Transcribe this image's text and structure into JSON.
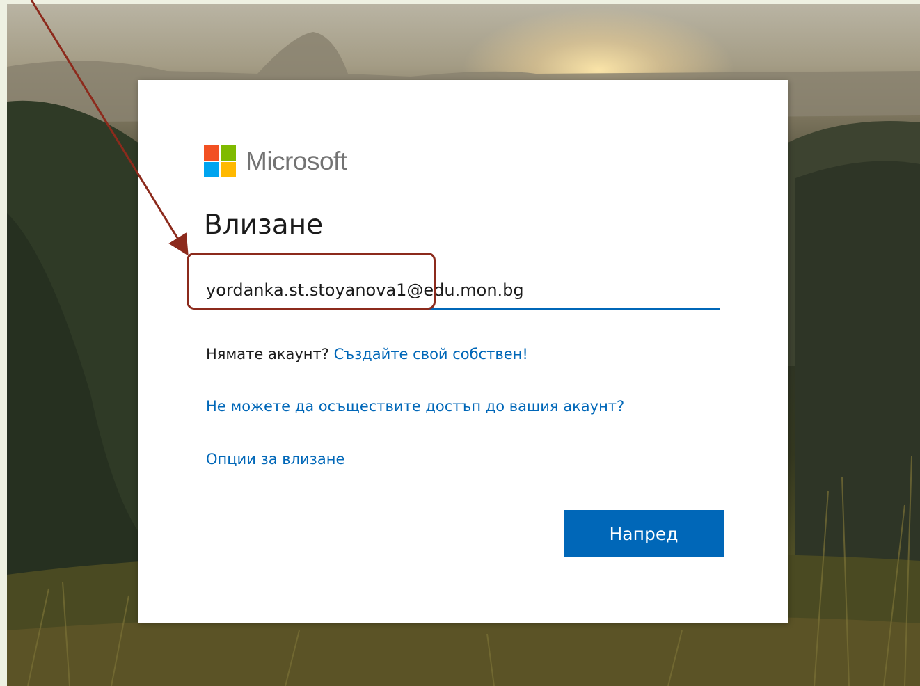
{
  "brand": {
    "name": "Microsoft",
    "colors": {
      "red": "#f25022",
      "green": "#7fba00",
      "blue": "#00a4ef",
      "yellow": "#ffb900",
      "accent": "#0067b8"
    }
  },
  "signin": {
    "title": "Влизане",
    "email_username": "yordanka.st.stoyanova1",
    "email_domain": "@edu.mon.bg",
    "no_account_text": "Нямате акаунт?",
    "create_account_link": "Създайте свой собствен!",
    "cant_access_link": "Не можете да осъществите достъп до вашия акаунт?",
    "signin_options_link": "Опции за влизане",
    "next_button": "Напред"
  },
  "annotation": {
    "color": "#8c2a1c",
    "target": "email-username"
  }
}
